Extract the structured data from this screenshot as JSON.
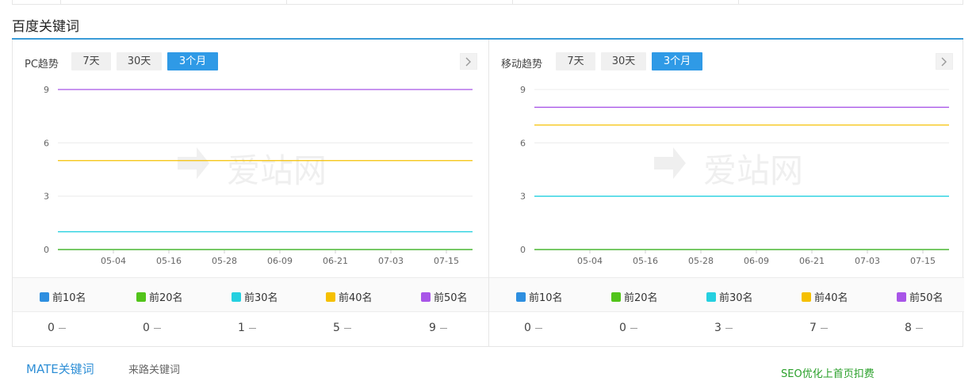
{
  "section": {
    "title": "百度关键词"
  },
  "panels": [
    {
      "label": "PC趋势",
      "ranges": [
        "7天",
        "30天",
        "3个月"
      ],
      "active_range": "3个月",
      "watermark": "爱站网",
      "legend": [
        "前10名",
        "前20名",
        "前30名",
        "前40名",
        "前50名"
      ],
      "values": [
        "0",
        "0",
        "1",
        "5",
        "9"
      ]
    },
    {
      "label": "移动趋势",
      "ranges": [
        "7天",
        "30天",
        "3个月"
      ],
      "active_range": "3个月",
      "watermark": "爱站网",
      "legend": [
        "前10名",
        "前20名",
        "前30名",
        "前40名",
        "前50名"
      ],
      "values": [
        "0",
        "0",
        "3",
        "7",
        "8"
      ]
    }
  ],
  "series_colors": [
    "#2e8fe0",
    "#52c41a",
    "#25d0e0",
    "#f5c000",
    "#a855e8"
  ],
  "bottom": {
    "tab_a": "MATE关键词",
    "tab_b": "来路关键词",
    "seo_link": "SEO优化上首页扣费"
  },
  "chart_data": [
    {
      "type": "line",
      "x": [
        "05-04",
        "05-16",
        "05-28",
        "06-09",
        "06-21",
        "07-03",
        "07-15"
      ],
      "ylim": [
        0,
        9
      ],
      "yticks": [
        "0",
        "3",
        "6",
        "9"
      ],
      "series": [
        {
          "name": "前10名",
          "color": "#2e8fe0",
          "values": [
            0,
            0,
            0,
            0,
            0,
            0,
            0
          ]
        },
        {
          "name": "前20名",
          "color": "#52c41a",
          "values": [
            0,
            0,
            0,
            0,
            0,
            0,
            0
          ]
        },
        {
          "name": "前30名",
          "color": "#25d0e0",
          "values": [
            1,
            1,
            1,
            1,
            1,
            1,
            1
          ]
        },
        {
          "name": "前40名",
          "color": "#f5c000",
          "values": [
            5,
            5,
            5,
            5,
            5,
            5,
            5
          ]
        },
        {
          "name": "前50名",
          "color": "#a855e8",
          "values": [
            9,
            9,
            9,
            9,
            9,
            9,
            9
          ]
        }
      ]
    },
    {
      "type": "line",
      "x": [
        "05-04",
        "05-16",
        "05-28",
        "06-09",
        "06-21",
        "07-03",
        "07-15"
      ],
      "ylim": [
        0,
        9
      ],
      "yticks": [
        "0",
        "3",
        "6",
        "9"
      ],
      "series": [
        {
          "name": "前10名",
          "color": "#2e8fe0",
          "values": [
            0,
            0,
            0,
            0,
            0,
            0,
            0
          ]
        },
        {
          "name": "前20名",
          "color": "#52c41a",
          "values": [
            0,
            0,
            0,
            0,
            0,
            0,
            0
          ]
        },
        {
          "name": "前30名",
          "color": "#25d0e0",
          "values": [
            3,
            3,
            3,
            3,
            3,
            3,
            3
          ]
        },
        {
          "name": "前40名",
          "color": "#f5c000",
          "values": [
            7,
            7,
            7,
            7,
            7,
            7,
            7
          ]
        },
        {
          "name": "前50名",
          "color": "#a855e8",
          "values": [
            8,
            8,
            8,
            8,
            8,
            8,
            8
          ]
        }
      ]
    }
  ]
}
